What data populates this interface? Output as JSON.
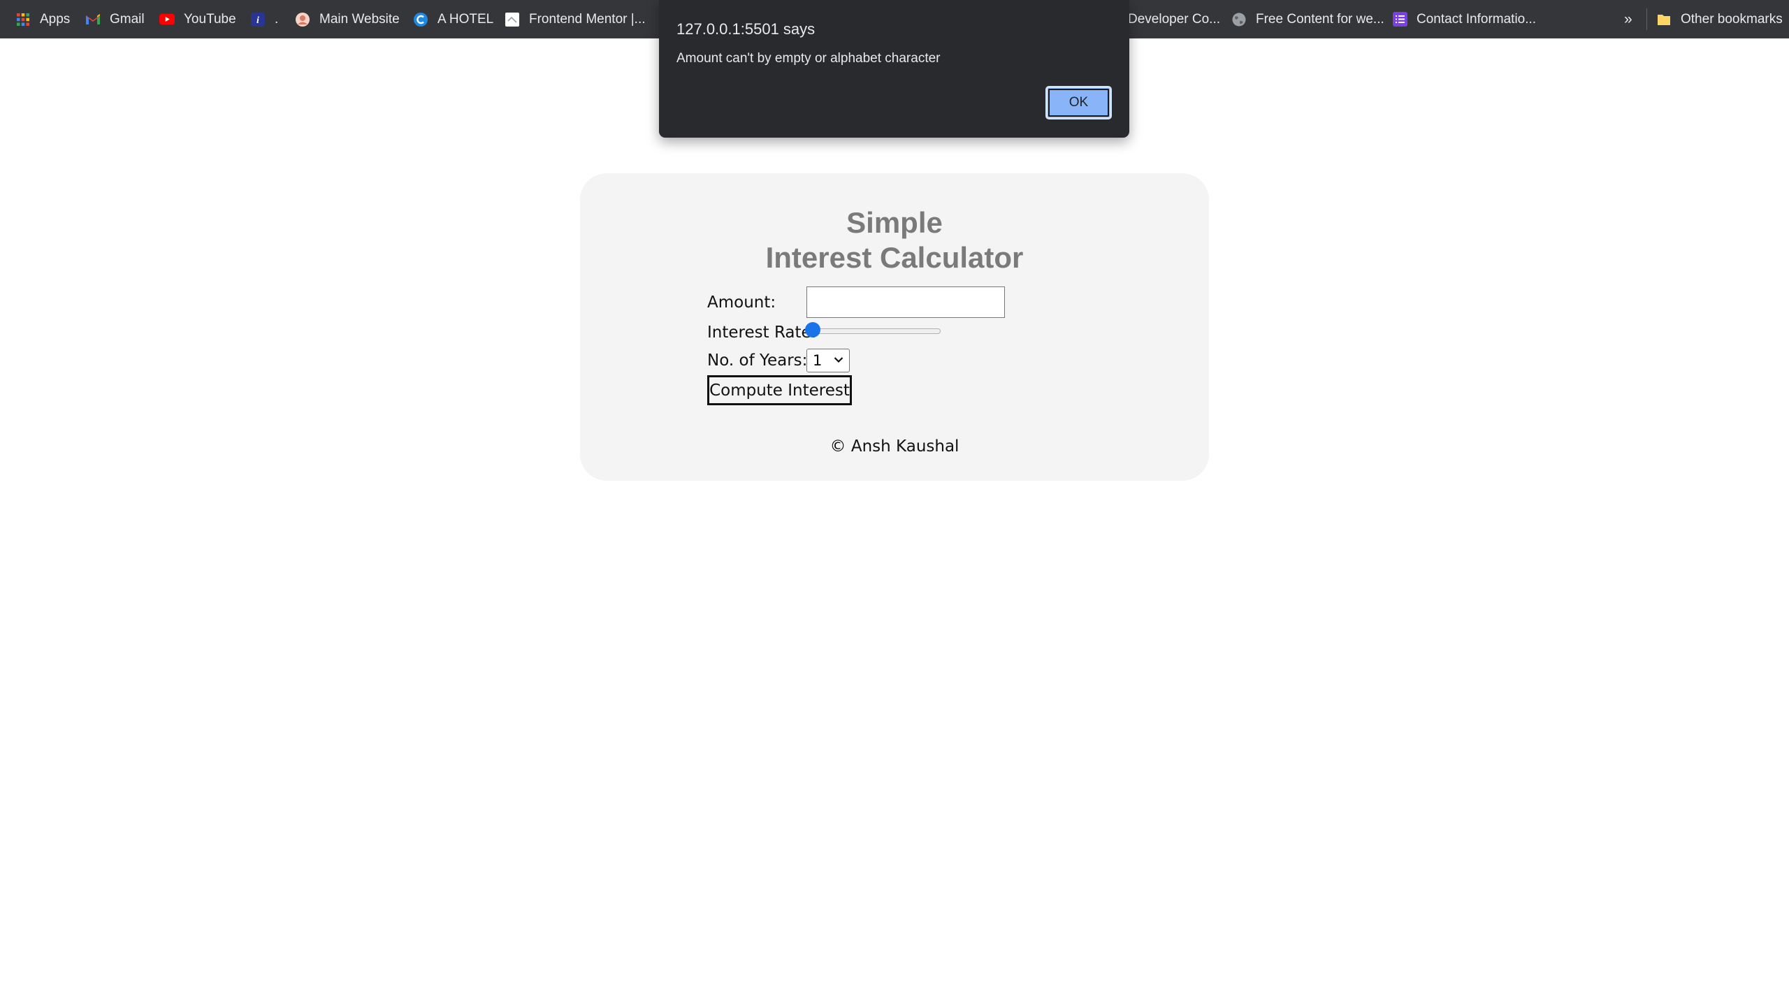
{
  "bookmarks_bar": {
    "items": [
      {
        "label": "Apps",
        "icon": "apps-grid-icon"
      },
      {
        "label": "Gmail",
        "icon": "gmail-icon"
      },
      {
        "label": "YouTube",
        "icon": "youtube-icon"
      },
      {
        "label": ".",
        "icon": "italic-i-icon"
      },
      {
        "label": "Main Website",
        "icon": "main-website-icon"
      },
      {
        "label": "A HOTEL",
        "icon": "c-logo-icon"
      },
      {
        "label": "Frontend Mentor |...",
        "icon": "page-icon"
      },
      {
        "label": "Developer Co...",
        "icon": ""
      },
      {
        "label": "Free Content for we...",
        "icon": "globe-icon"
      },
      {
        "label": "Contact Informatio...",
        "icon": "list-icon"
      }
    ],
    "overflow": "»",
    "other_bookmarks": "Other bookmarks"
  },
  "dialog": {
    "title": "127.0.0.1:5501 says",
    "message": "Amount can't by empty or alphabet character",
    "ok_label": "OK"
  },
  "calculator": {
    "title_line1": "Simple",
    "title_line2": "Interest Calculator",
    "amount_label": "Amount:",
    "amount_value": "",
    "rate_label": "Interest Rate:",
    "rate_fraction": 0,
    "years_label": "No. of Years:",
    "years_selected": "1",
    "compute_label": "Compute Interest",
    "footer": "© Ansh Kaushal"
  },
  "colors": {
    "bookmarks_bg": "#35363a",
    "dialog_bg": "#292a2d",
    "ok_button": "#8ab4f8",
    "card_bg": "#f4f4f4",
    "title_gray": "#7a7a7a",
    "slider_accent": "#1a73e8"
  }
}
